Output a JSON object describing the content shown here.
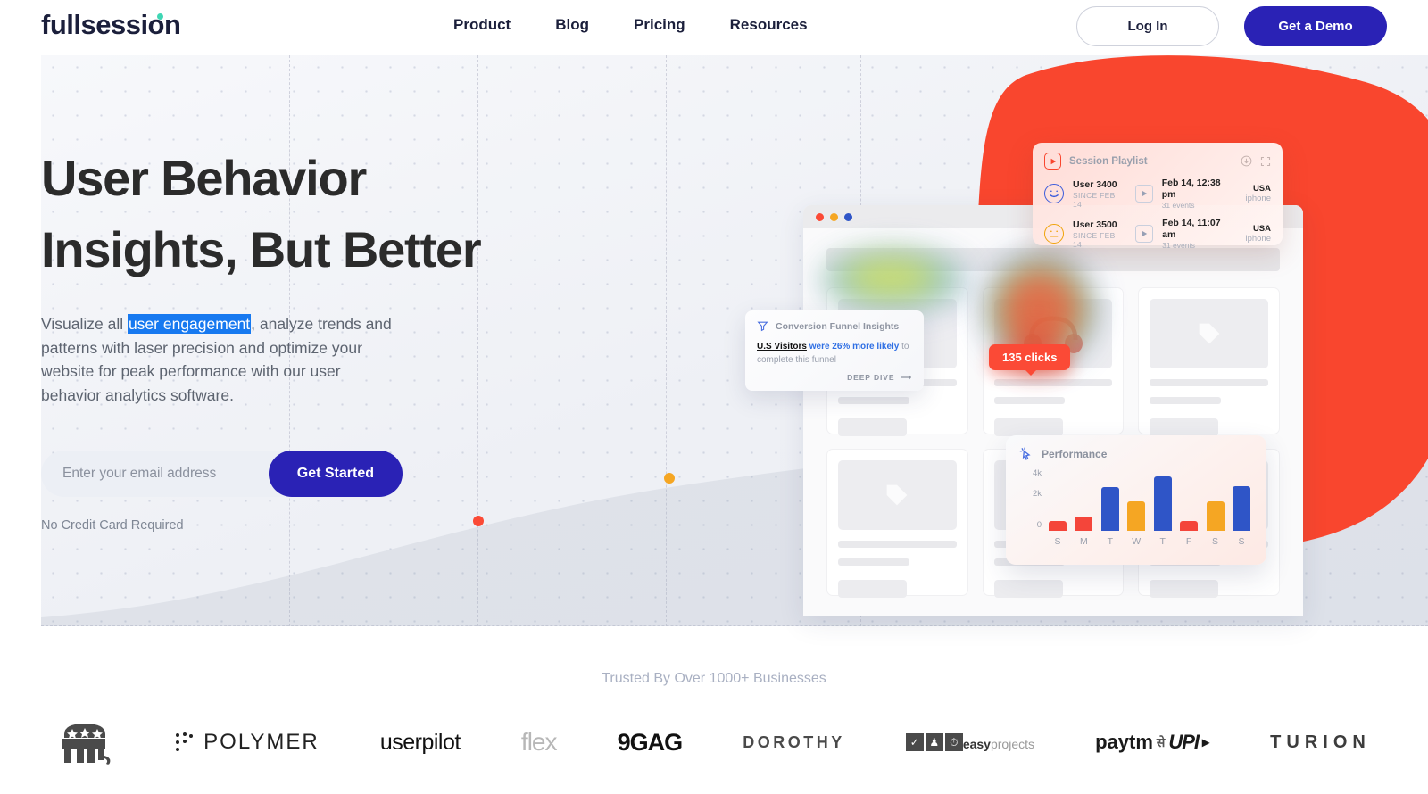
{
  "brand": {
    "name": "fullsession",
    "dot_color": "#3fd6b4",
    "navy": "#1b1f3b",
    "primary": "#2a22b5",
    "red": "#fb4a36"
  },
  "header": {
    "nav": [
      {
        "label": "Product"
      },
      {
        "label": "Blog"
      },
      {
        "label": "Pricing"
      },
      {
        "label": "Resources"
      }
    ],
    "login_label": "Log In",
    "demo_label": "Get a Demo"
  },
  "hero": {
    "headline_line1": "User Behavior",
    "headline_line2": "Insights, But Better",
    "sub_before": "Visualize all ",
    "sub_highlight": "user engagement",
    "sub_after": ", analyze trends and patterns with laser precision and optimize your website for peak performance with our user behavior analytics software.",
    "highlight_color": "#1779f0",
    "email_placeholder": "Enter your email address",
    "email_value": "",
    "cta_label": "Get Started",
    "no_cc": "No Credit Card Required"
  },
  "playlist": {
    "title": "Session Playlist",
    "rows": [
      {
        "user": "User 3400",
        "since": "SINCE FEB 14",
        "time": "Feb 14, 12:38 pm",
        "events": "31 events",
        "country": "USA",
        "device": "iphone",
        "mood": "happy"
      },
      {
        "user": "User 3500",
        "since": "SINCE FEB 14",
        "time": "Feb 14, 11:07 am",
        "events": "31 events",
        "country": "USA",
        "device": "iphone",
        "mood": "neutral"
      }
    ]
  },
  "funnel": {
    "title": "Conversion Funnel Insights",
    "line_us": "U.S Visitors",
    "line_blue": " were 26% more likely",
    "line_gray": " to complete this funnel",
    "deep_dive": "DEEP DIVE"
  },
  "clicks_badge": {
    "label": "135 clicks"
  },
  "chart_data": {
    "type": "bar",
    "title": "Performance",
    "categories": [
      "S",
      "M",
      "T",
      "W",
      "T",
      "F",
      "S",
      "S"
    ],
    "values": [
      900,
      1350,
      4200,
      2800,
      5200,
      900,
      2800,
      4300
    ],
    "colors": [
      "#f4453a",
      "#f4453a",
      "#2f55c7",
      "#f5a623",
      "#2f55c7",
      "#f4453a",
      "#f5a623",
      "#2f55c7"
    ],
    "ytick_labels": [
      "4k",
      "2k",
      "0"
    ],
    "ylim": [
      0,
      6000
    ],
    "xlabel": "",
    "ylabel": "",
    "grid": false,
    "legend": "none"
  },
  "trusted": {
    "caption": "Trusted By Over 1000+ Businesses",
    "logos": [
      {
        "name": "gop-elephant",
        "label": ""
      },
      {
        "name": "polymer",
        "label": "POLYMER"
      },
      {
        "name": "userpilot",
        "label": "userpilot"
      },
      {
        "name": "flex",
        "label": "flex"
      },
      {
        "name": "9gag",
        "label": "9GAG"
      },
      {
        "name": "dorothy",
        "label": "DOROTHY"
      },
      {
        "name": "easyprojects",
        "label_bold": "easy",
        "label_light": "projects"
      },
      {
        "name": "paytm-upi",
        "label": "paytm",
        "label2": "UPI"
      },
      {
        "name": "turion",
        "label": "TURION"
      }
    ]
  }
}
